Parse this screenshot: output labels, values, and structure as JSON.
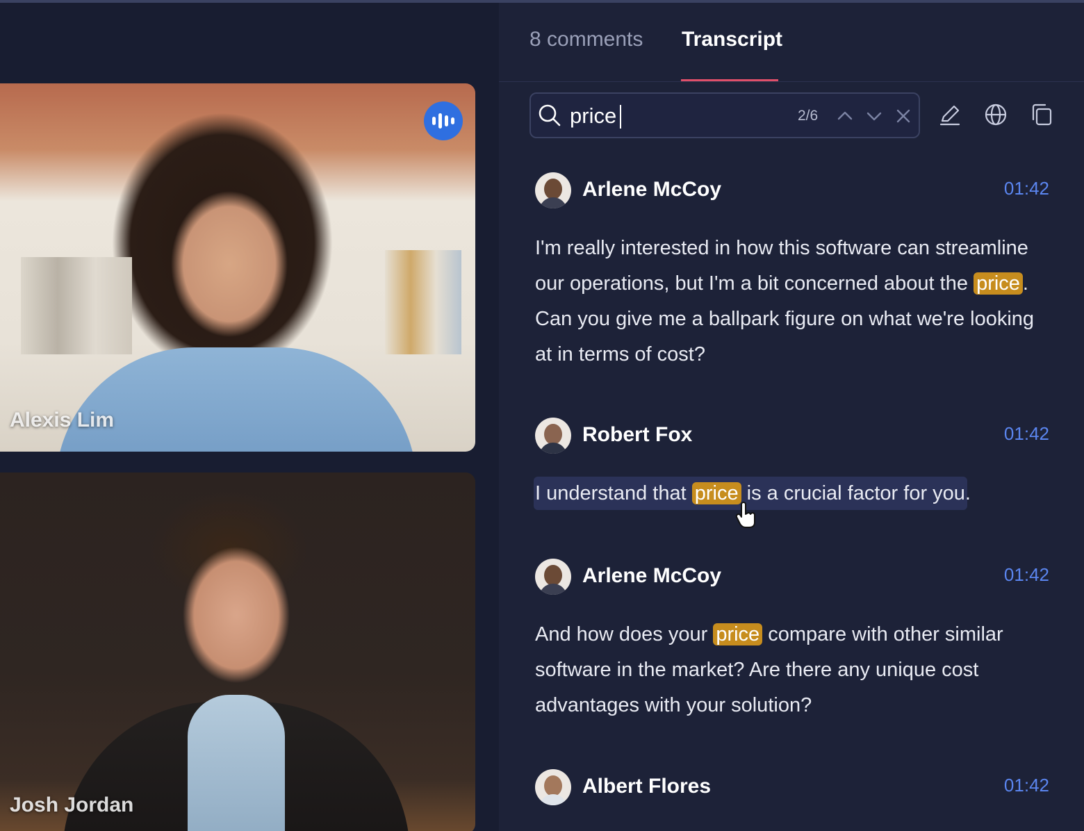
{
  "video": {
    "participants": [
      {
        "name": "Alexis Lim"
      },
      {
        "name": "Josh Jordan"
      }
    ]
  },
  "tabs": {
    "comments": "8 comments",
    "transcript": "Transcript"
  },
  "search": {
    "value": "price",
    "match_count": "2/6"
  },
  "transcript": [
    {
      "speaker": "Arlene McCoy",
      "time": "01:42",
      "parts": [
        "I'm really interested in how this software can streamline our operations, but I'm a bit concerned about the ",
        "price",
        ". Can you give me a ballpark figure on what we're looking at in terms of cost?"
      ]
    },
    {
      "speaker": "Robert Fox",
      "time": "01:42",
      "parts": [
        "I understand that ",
        "price",
        " is a crucial factor for you."
      ]
    },
    {
      "speaker": "Arlene McCoy",
      "time": "01:42",
      "parts": [
        "And how does your ",
        "price",
        " compare with other similar software in the market? Are there any unique cost advantages with your solution?"
      ]
    },
    {
      "speaker": "Albert Flores",
      "time": "01:42"
    }
  ],
  "colors": {
    "accent_tab": "#e0506a",
    "timestamp": "#5b86f0",
    "highlight": "#c78d1e"
  },
  "icons": [
    "search-icon",
    "chevron-up-icon",
    "chevron-down-icon",
    "close-icon",
    "pencil-icon",
    "globe-icon",
    "copy-icon",
    "audio-speaking-icon",
    "hand-pointer-icon"
  ]
}
